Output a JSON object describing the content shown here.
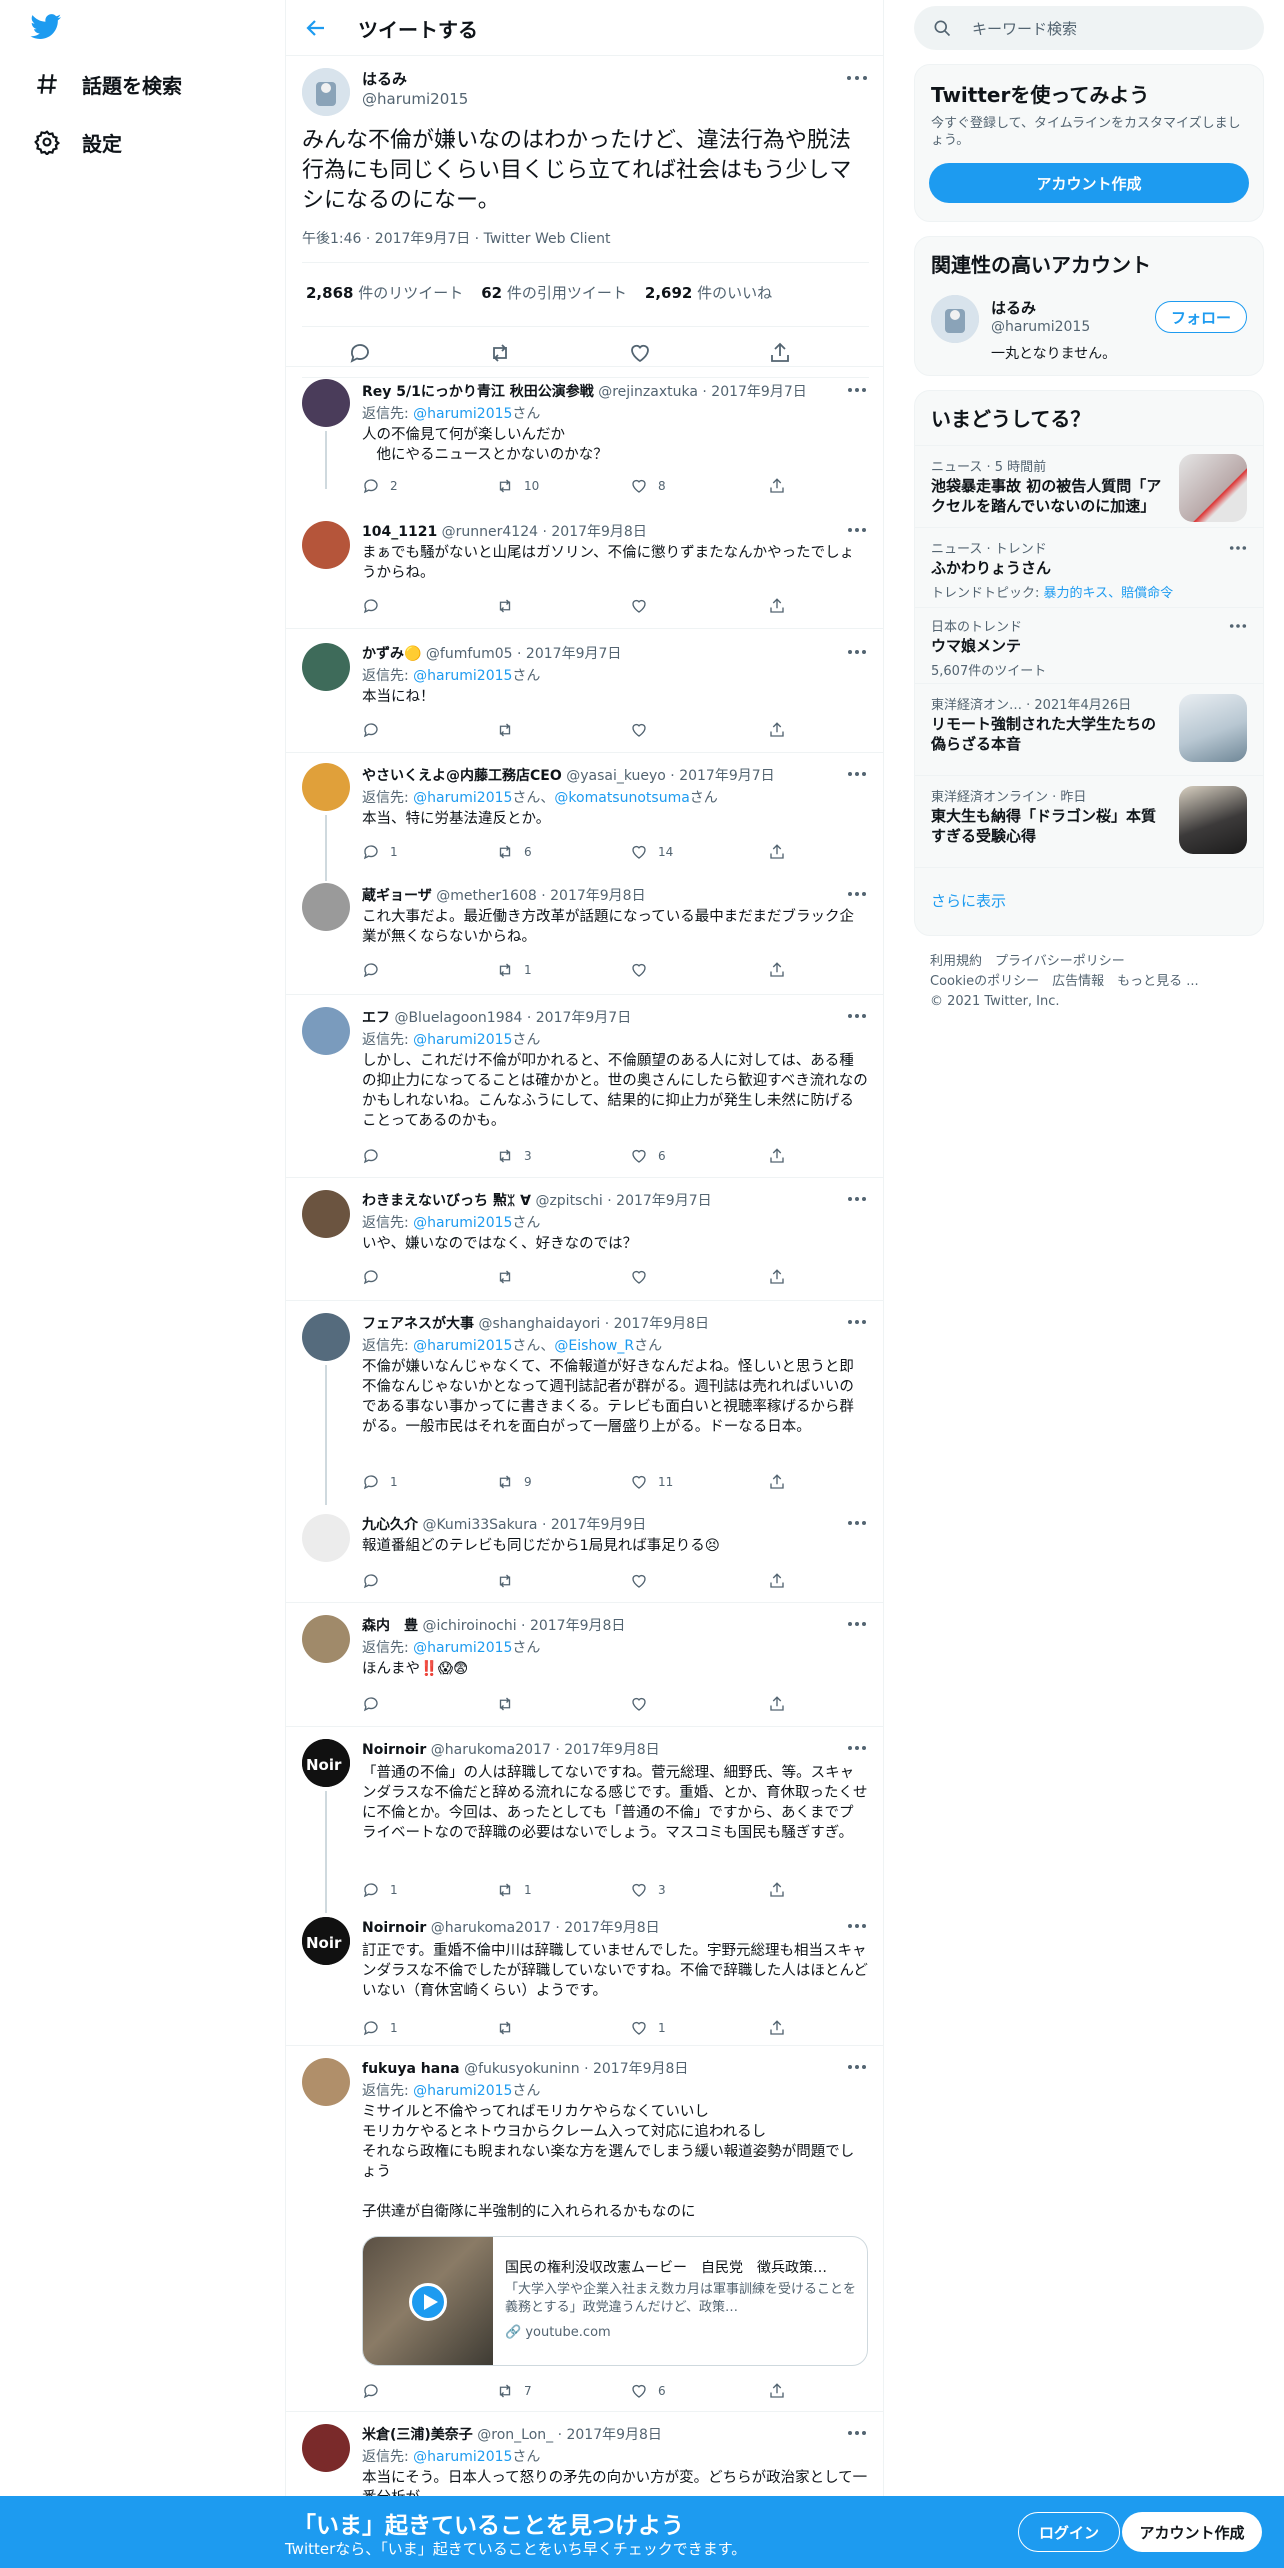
{
  "nav": {
    "explore_label": "話題を検索",
    "settings_label": "設定"
  },
  "header": {
    "title": "ツイートする"
  },
  "main_tweet": {
    "name": "はるみ",
    "handle": "@harumi2015",
    "text": "みんな不倫が嫌いなのはわかったけど、違法行為や脱法行為にも同じくらい目くじら立てれば社会はもう少しマシになるのになー。",
    "meta": "午後1:46 · 2017年9月7日 · Twitter Web Client",
    "retweets_num": "2,868",
    "retweets_label": " 件のリツイート",
    "quotes_num": "62",
    "quotes_label": " 件の引用ツイート",
    "likes_num": "2,692",
    "likes_label": " 件のいいね"
  },
  "replies": [
    {
      "name": "Rey 5/1にっかり青江 秋田公演参戦",
      "handle": "@rejinzaxtuka · 2017年9月7日",
      "reply_to": "返信先: ",
      "mention": "@harumi2015",
      "suffix": "さん",
      "text": "人の不倫見て何が楽しいんだか\n　他にやるニュースとかないのかな？",
      "reply": "2",
      "rt": "10",
      "like": "8"
    },
    {
      "name": "104_1121",
      "handle": "@runner4124 · 2017年9月8日",
      "text": "まぁでも騒がないと山尾はガソリン、不倫に懲りずまたなんかやったでしょうからね。",
      "reply": "",
      "rt": "",
      "like": ""
    },
    {
      "name": "かずみ🟡",
      "handle": "@fumfum05 · 2017年9月7日",
      "reply_to": "返信先: ",
      "mention": "@harumi2015",
      "suffix": "さん",
      "text": "本当にね！",
      "reply": "",
      "rt": "",
      "like": ""
    },
    {
      "name": "やさいくえよ@内藤工務店CEO",
      "handle": "@yasai_kueyo · 2017年9月7日",
      "reply_to": "返信先: ",
      "mention": "@harumi2015",
      "mention2": "さん、",
      "mention3": "@komatsunotsuma",
      "suffix": "さん",
      "text": "本当、特に労基法違反とか。",
      "reply": "1",
      "rt": "6",
      "like": "14"
    },
    {
      "name": "蔵ギョーザ",
      "handle": "@mether1608 · 2017年9月8日",
      "text": "これ大事だよ。最近働き方改革が話題になっている最中まだまだブラック企業が無くならないからね。",
      "reply": "",
      "rt": "1",
      "like": ""
    },
    {
      "name": "エフ",
      "handle": "@Bluelagoon1984 · 2017年9月7日",
      "reply_to": "返信先: ",
      "mention": "@harumi2015",
      "suffix": "さん",
      "text": "しかし、これだけ不倫が叩かれると、不倫願望のある人に対しては、ある種の抑止力になってることは確かかと。世の奥さんにしたら歓迎すべき流れなのかもしれないね。こんなふうにして、結果的に抑止力が発生し未然に防げることってあるのかも。",
      "reply": "",
      "rt": "3",
      "like": "6"
    },
    {
      "name": "わきまえないびっち 㸃ᛯ ∀",
      "handle": "@zpitschi · 2017年9月7日",
      "reply_to": "返信先: ",
      "mention": "@harumi2015",
      "suffix": "さん",
      "text": "いや、嫌いなのではなく、好きなのでは？",
      "reply": "",
      "rt": "",
      "like": ""
    },
    {
      "name": "フェアネスが大事",
      "handle": "@shanghaidayori · 2017年9月8日",
      "reply_to": "返信先: ",
      "mention": "@harumi2015",
      "mention2": "さん、",
      "mention3": "@Eishow_R",
      "suffix": "さん",
      "text": "不倫が嫌いなんじゃなくて、不倫報道が好きなんだよね。怪しいと思うと即不倫なんじゃないかとなって週刊誌記者が群がる。週刊誌は売れればいいのである事ない事かってに書きまくる。テレビも面白いと視聴率稼げるから群がる。一般市民はそれを面白がって一層盛り上がる。ドーなる日本。",
      "reply": "1",
      "rt": "9",
      "like": "11"
    },
    {
      "name": "九心久介",
      "handle": "@Kumi33Sakura · 2017年9月9日",
      "text": "報道番組どのテレビも同じだから1局見れば事足りる😣",
      "reply": "",
      "rt": "",
      "like": ""
    },
    {
      "name": "森内　豊",
      "handle": "@ichiroinochi · 2017年9月8日",
      "reply_to": "返信先: ",
      "mention": "@harumi2015",
      "suffix": "さん",
      "text": "ほんまや‼️😱😨",
      "reply": "",
      "rt": "",
      "like": ""
    },
    {
      "name": "Noirnoir",
      "handle": "@harukoma2017 · 2017年9月8日",
      "text": "「普通の不倫」の人は辞職してないですね。菅元総理、細野氏、等。スキャンダラスな不倫だと辞める流れになる感じです。重婚、とか、育休取ったくせに不倫とか。今回は、あったとしても「普通の不倫」ですから、あくまでプライベートなので辞職の必要はないでしょう。マスコミも国民も騒ぎすぎ。",
      "reply": "1",
      "rt": "1",
      "like": "3"
    },
    {
      "name": "Noirnoir",
      "handle": "@harukoma2017 · 2017年9月8日",
      "text": "訂正です。重婚不倫中川は辞職していませんでした。宇野元総理も相当スキャンダラスな不倫でしたが辞職していないですね。不倫で辞職した人はほとんどいない（育休宮崎くらい）ようです。",
      "reply": "1",
      "rt": "",
      "like": "1"
    },
    {
      "name": "fukuya hana",
      "handle": "@fukusyokuninn · 2017年9月8日",
      "reply_to": "返信先: ",
      "mention": "@harumi2015",
      "suffix": "さん",
      "text": "ミサイルと不倫やってればモリカケやらなくていいし\nモリカケやるとネトウヨからクレーム入って対応に追われるし\nそれなら政権にも睨まれない楽な方を選んでしまう緩い報道姿勢が問題でしょう\n\n子供達が自衛隊に半強制的に入れられるかもなのに",
      "reply": "",
      "rt": "7",
      "like": "6",
      "card_title": "国民の権利没収改憲ムービー　自民党　徴兵政策…",
      "card_desc": "「大学入学や企業入社まえ数カ月は軍事訓練を受けることを義務とする」政党違うんだけど、政策…",
      "card_url": "youtube.com"
    },
    {
      "name": "米倉(三浦)美奈子",
      "handle": "@ron_Lon_ · 2017年9月8日",
      "reply_to": "返信先: ",
      "mention": "@harumi2015",
      "suffix": "さん",
      "text": "本当にそう。日本人って怒りの矛先の向かい方が変。どちらが政治家として一番分析が",
      "reply": "",
      "rt": "",
      "like": ""
    }
  ],
  "right": {
    "search_placeholder": "キーワード検索",
    "join_title": "Twitterを使ってみよう",
    "join_desc": "今すぐ登録して、タイムラインをカスタマイズしましょう。",
    "join_button": "アカウント作成",
    "related_title": "関連性の高いアカウント",
    "related_name": "はるみ",
    "related_handle": "@harumi2015",
    "related_bio": "一丸となりません。",
    "follow_button": "フォロー",
    "trends_title": "いまどうしてる？",
    "trends": [
      {
        "cat": "ニュース · 5 時間前",
        "title": "池袋暴走事故 初の被告人質問「アクセルを踏んでいないのに加速」"
      },
      {
        "cat": "ニュース · トレンド",
        "title": "ふかわりょうさん",
        "sub": "トレンドトピック: ",
        "sub_m": "暴力的キス、賠償命令"
      },
      {
        "cat": "日本のトレンド",
        "title": "ウマ娘メンテ",
        "sub": "5,607件のツイート"
      },
      {
        "cat": "東洋経済オン… · 2021年4月26日",
        "title": "リモート強制された大学生たちの偽らざる本音"
      },
      {
        "cat": "東洋経済オンライン · 昨日",
        "title": "東大生も納得「ドラゴン桜」本質すぎる受験心得"
      }
    ],
    "show_more": "さらに表示",
    "footer_line1": "利用規約　プライバシーポリシー",
    "footer_line2": "Cookieのポリシー　広告情報　もっと見る ...",
    "footer_line3": "© 2021 Twitter, Inc."
  },
  "banner": {
    "title": "「いま」起きていることを見つけよう",
    "sub": "Twitterなら、「いま」起きていることをいち早くチェックできます。",
    "login": "ログイン",
    "signup": "アカウント作成"
  },
  "colors": {
    "accent": "#1d9bf0",
    "text": "#0f1419",
    "muted": "#536471"
  }
}
